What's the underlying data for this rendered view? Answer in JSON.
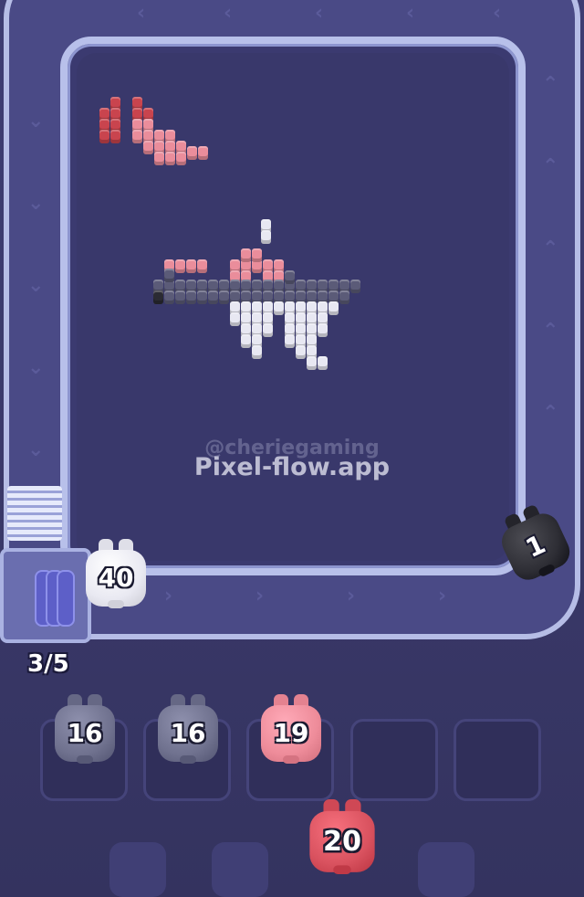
{
  "game": {
    "watermark_handle": "@cheriegaming",
    "watermark_site": "Pixel-flow.app",
    "queue_counter": "3/5"
  },
  "conveyor_pigs": [
    {
      "count": "40",
      "color": "#e9e9f2"
    },
    {
      "count": "1",
      "color": "#2e2e35"
    }
  ],
  "slot_pigs": [
    {
      "count": "16",
      "color": "#70728f"
    },
    {
      "count": "16",
      "color": "#70728f"
    },
    {
      "count": "19",
      "color": "#ee8c9a"
    }
  ],
  "next_pig": {
    "count": "20",
    "color": "#d9525f"
  },
  "palette": {
    "red": "#c9444e",
    "pink": "#ea8d9b",
    "dark_gray": "#5b5b78",
    "white": "#e8e8f2",
    "black": "#2b2b33"
  }
}
